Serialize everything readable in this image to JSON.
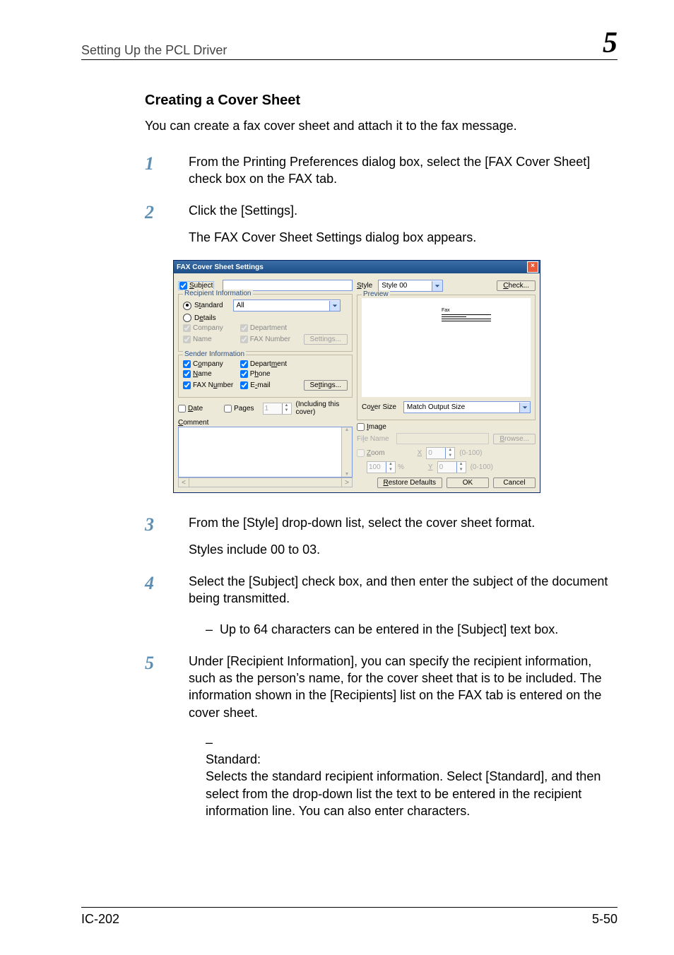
{
  "header": {
    "section": "Setting Up the PCL Driver",
    "chapter_no": "5"
  },
  "content": {
    "heading": "Creating a Cover Sheet",
    "intro": "You can create a fax cover sheet and attach it to the fax message.",
    "steps": [
      {
        "no": "1",
        "text": "From the Printing Preferences dialog box, select the [FAX Cover Sheet] check box on the FAX tab."
      },
      {
        "no": "2",
        "text": "Click the [Settings].",
        "after": "The FAX Cover Sheet Settings dialog box appears."
      },
      {
        "no": "3",
        "text": "From the [Style] drop-down list, select the cover sheet format.",
        "after": "Styles include 00 to 03."
      },
      {
        "no": "4",
        "text": "Select the [Subject] check box, and then enter the subject of the document being transmitted.",
        "bullets": [
          "Up to 64 characters can be entered in the [Subject] text box."
        ]
      },
      {
        "no": "5",
        "text": "Under [Recipient Information], you can specify the recipient information, such as the person’s name, for the cover sheet that is to be included. The information shown in the [Recipients] list on the FAX tab is entered on the cover sheet.",
        "bullets_head": "Standard:",
        "bullets_body": "Selects the standard recipient information. Select [Standard], and then select from the drop-down list the text to be entered in the recipient information line. You can also enter characters."
      }
    ]
  },
  "dialog": {
    "title": "FAX Cover Sheet Settings",
    "subject_label": "Subject",
    "recipient_group": "Recipient Information",
    "standard_label": "Standard",
    "standard_value": "All",
    "details_label": "Details",
    "company_label": "Company",
    "department_label": "Department",
    "name_label": "Name",
    "faxnumber_label": "FAX Number",
    "settings_btn": "Settings...",
    "sender_group": "Sender Information",
    "sender_company": "Company",
    "sender_department": "Department",
    "sender_name": "Name",
    "sender_phone": "Phone",
    "sender_fax": "FAX Number",
    "sender_email": "E-mail",
    "sender_settings_btn": "Settings...",
    "date_label": "Date",
    "pages_label": "Pages",
    "pages_value": "1",
    "pages_note": "(Including this cover)",
    "comment_label": "Comment",
    "style_label": "Style",
    "style_value": "Style 00",
    "check_btn": "Check...",
    "preview_label": "Preview",
    "preview_text": "Fax",
    "cover_size_label": "Cover Size",
    "cover_size_value": "Match Output Size",
    "image_label": "Image",
    "filename_label": "File Name",
    "browse_btn": "Browse...",
    "zoom_label": "Zoom",
    "zoom_value": "100",
    "x_label": "X",
    "x_value": "0",
    "y_label": "Y",
    "y_value": "0",
    "range_label": "(0-100)",
    "restore_btn": "Restore Defaults",
    "ok_btn": "OK",
    "cancel_btn": "Cancel"
  },
  "footer": {
    "left": "IC-202",
    "right": "5-50"
  }
}
